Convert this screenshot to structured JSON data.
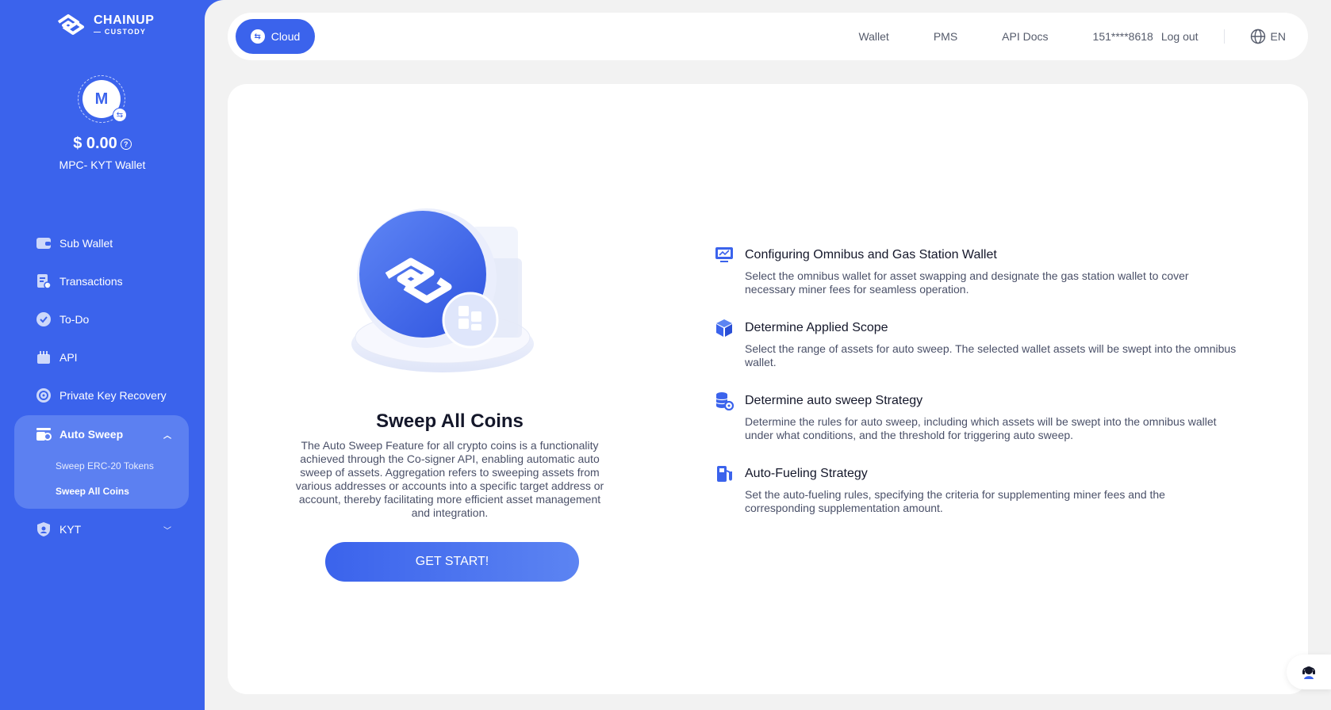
{
  "brand": {
    "name": "CHAINUP",
    "sub": "— CUSTODY"
  },
  "account": {
    "avatar_letter": "M",
    "balance": "$ 0.00",
    "wallet_name": "MPC- KYT Wallet"
  },
  "sidebar": {
    "items": [
      {
        "label": "Sub Wallet",
        "icon": "wallet-icon"
      },
      {
        "label": "Transactions",
        "icon": "transactions-icon"
      },
      {
        "label": "To-Do",
        "icon": "check-icon"
      },
      {
        "label": "API",
        "icon": "api-icon"
      },
      {
        "label": "Private Key Recovery",
        "icon": "key-recovery-icon"
      }
    ],
    "group": {
      "label": "Auto Sweep",
      "icon": "sweep-icon",
      "sub_items": [
        "Sweep ERC-20 Tokens",
        "Sweep All Coins"
      ]
    },
    "kyt": {
      "label": "KYT",
      "icon": "shield-icon"
    }
  },
  "topbar": {
    "cloud_label": "Cloud",
    "links": [
      "Wallet",
      "PMS",
      "API Docs"
    ],
    "user_id": "151****8618",
    "logout": "Log out",
    "lang": "EN"
  },
  "hero": {
    "title": "Sweep All Coins",
    "description": "The Auto Sweep Feature for all crypto coins is a functionality achieved through the Co-signer API, enabling automatic auto sweep of assets. Aggregation refers to sweeping assets from various addresses or accounts into a specific target address or account, thereby facilitating more efficient asset management and integration.",
    "button": "GET START!"
  },
  "steps": [
    {
      "title": "Configuring Omnibus and Gas Station Wallet",
      "desc": "Select the omnibus wallet for asset swapping and designate the gas station wallet to cover necessary miner fees for seamless operation.",
      "icon": "monitor-icon"
    },
    {
      "title": "Determine Applied Scope",
      "desc": "Select the range of assets for auto sweep. The selected wallet assets will be swept into the omnibus wallet.",
      "icon": "cube-icon"
    },
    {
      "title": "Determine auto sweep Strategy",
      "desc": "Determine the rules for auto sweep, including which assets will be swept into the omnibus wallet under what conditions, and the threshold for triggering auto sweep.",
      "icon": "database-gear-icon"
    },
    {
      "title": "Auto-Fueling Strategy",
      "desc": "Set the auto-fueling rules, specifying the criteria for supplementing miner fees and the corresponding supplementation amount.",
      "icon": "fuel-icon"
    }
  ],
  "colors": {
    "primary": "#3b63ec",
    "sidebar_active": "#5c80f1",
    "background": "#f2f2f2"
  }
}
